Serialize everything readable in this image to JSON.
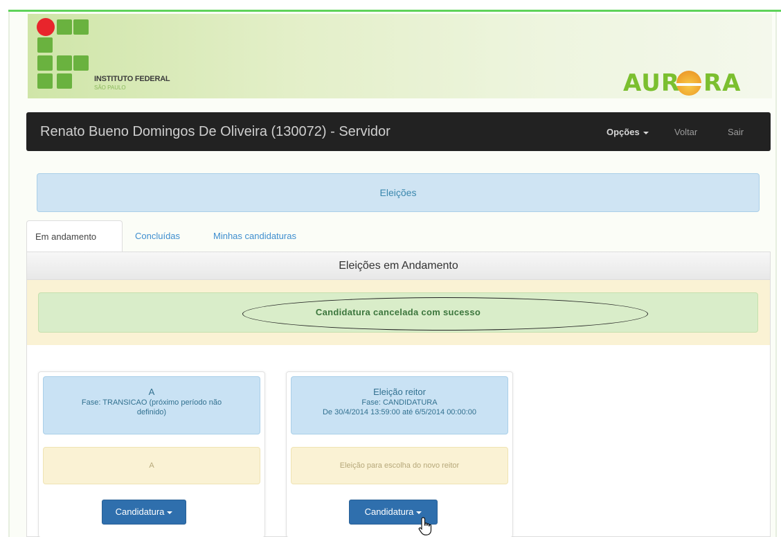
{
  "logo": {
    "name": "INSTITUTO FEDERAL",
    "subtitle": "SÃO PAULO"
  },
  "brand": {
    "left": "AUR",
    "right": "RA"
  },
  "navbar": {
    "user": "Renato Bueno Domingos De Oliveira (130072) - Servidor",
    "options_label": "Opções",
    "back_label": "Voltar",
    "exit_label": "Sair"
  },
  "page_title": "Eleições",
  "tabs": [
    {
      "label": "Em andamento"
    },
    {
      "label": "Concluídas"
    },
    {
      "label": "Minhas candidaturas"
    }
  ],
  "panel": {
    "heading": "Eleições em Andamento",
    "success_message": "Candidatura cancelada com sucesso"
  },
  "elections": [
    {
      "title": "A",
      "phase": "Fase: TRANSICAO (próximo período não definido)",
      "dates": "",
      "description": "A",
      "button_label": "Candidatura"
    },
    {
      "title": "Eleição reitor",
      "phase": "Fase: CANDIDATURA",
      "dates": "De 30/4/2014 13:59:00 até 6/5/2014 00:00:00",
      "description": "Eleição para escolha do novo reitor",
      "button_label": "Candidatura"
    }
  ],
  "colors": {
    "navbar": "#222222",
    "accent_green": "#7bbf2f",
    "logo_red": "#e8252c",
    "button_blue": "#2f6fad",
    "info_blue": "#cfe4f3",
    "success_green": "#d9edc9",
    "warning_yellow": "#faf2d4"
  }
}
